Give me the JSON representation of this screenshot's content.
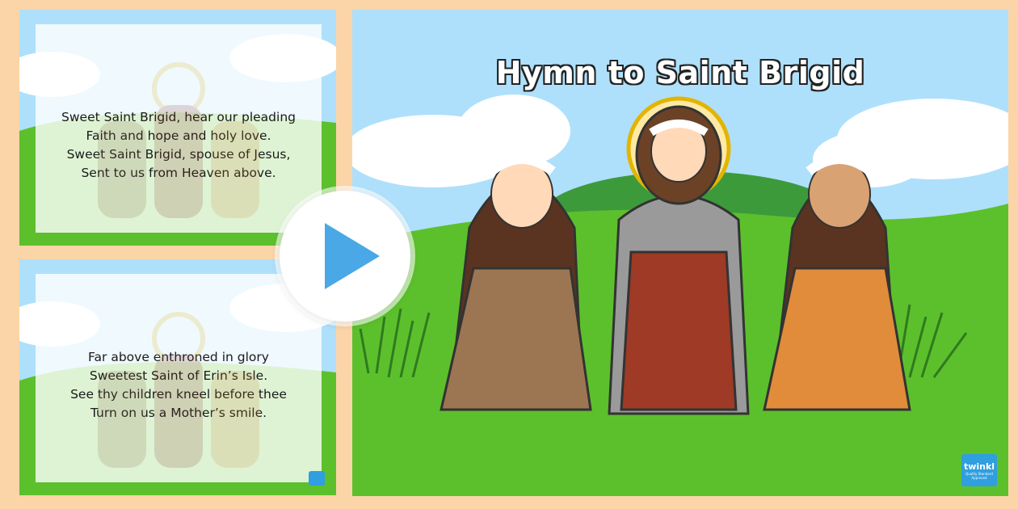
{
  "main_slide": {
    "title": "Hymn to Saint Brigid",
    "logo_text": "twinkl",
    "logo_caption": "Quality Standard Approved"
  },
  "thumbnails": [
    {
      "lines": [
        "Sweet Saint Brigid, hear our pleading",
        "Faith and hope and holy love.",
        "Sweet Saint Brigid, spouse of Jesus,",
        "Sent to us from Heaven above."
      ]
    },
    {
      "lines": [
        "Far above enthroned in glory",
        "Sweetest Saint of Erin’s Isle.",
        "See thy children kneel before thee",
        "Turn on us a Mother’s smile."
      ]
    }
  ],
  "colors": {
    "page_background": "#fbd5a8",
    "sky": "#aee0fb",
    "grass": "#5cc02c",
    "hill": "#3d9a3a",
    "play_triangle": "#4aa8e6"
  },
  "icons": {
    "play": "play-triangle-icon",
    "logo": "twinkl-logo-icon"
  }
}
